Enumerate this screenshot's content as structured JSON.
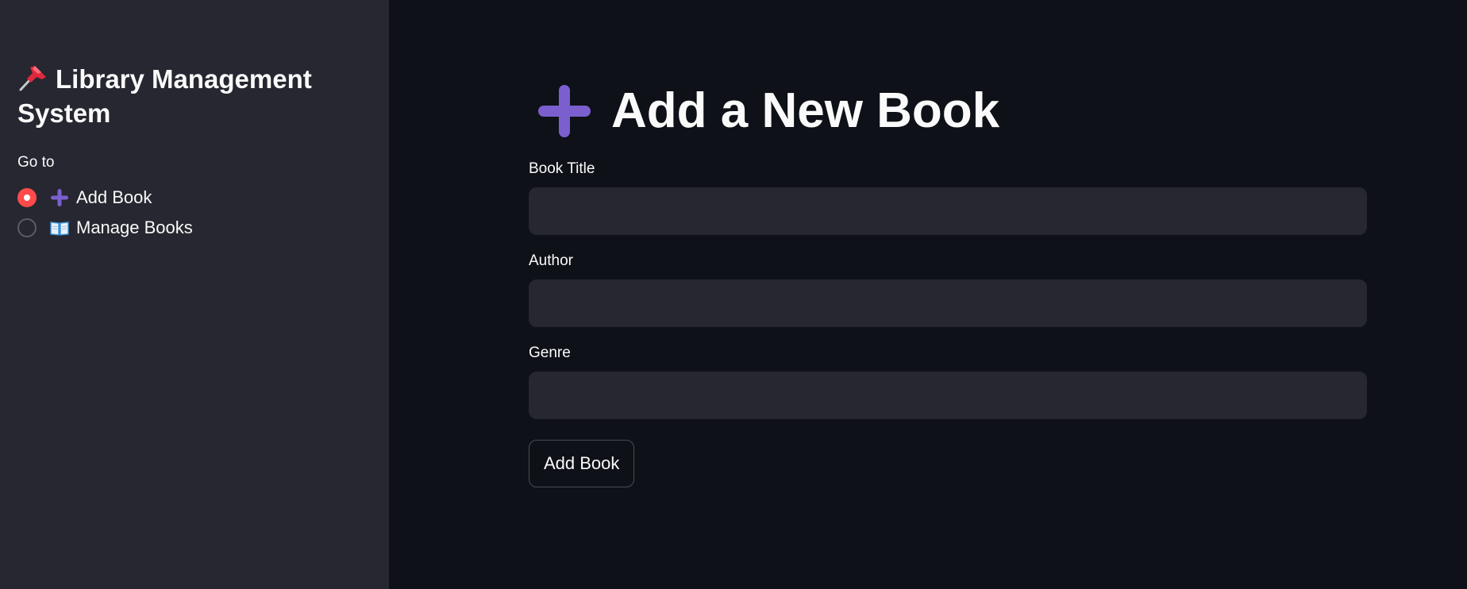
{
  "sidebar": {
    "title": "Library Management System",
    "title_icon": "pushpin-icon",
    "nav_label": "Go to",
    "options": [
      {
        "label": "Add Book",
        "icon": "plus-icon",
        "selected": true
      },
      {
        "label": "Manage Books",
        "icon": "open-book-icon",
        "selected": false
      }
    ]
  },
  "main": {
    "title": "Add a New Book",
    "title_icon": "plus-icon",
    "fields": [
      {
        "label": "Book Title",
        "value": ""
      },
      {
        "label": "Author",
        "value": ""
      },
      {
        "label": "Genre",
        "value": ""
      }
    ],
    "submit_label": "Add Book"
  },
  "colors": {
    "sidebar_bg": "#262730",
    "main_bg": "#0e1117",
    "accent": "#ff4b4b",
    "plus_icon": "#7b5fcf"
  }
}
